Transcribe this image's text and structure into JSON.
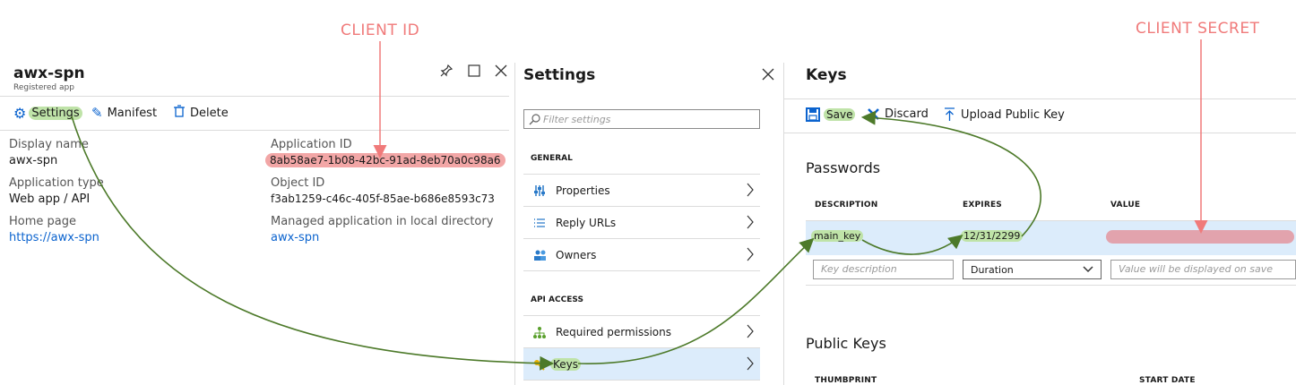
{
  "annotations": {
    "client_id": "CLIENT ID",
    "client_secret": "CLIENT SECRET"
  },
  "left_panel": {
    "title": "awx-spn",
    "subtitle": "Registered app",
    "toolbar": {
      "settings": "Settings",
      "manifest": "Manifest",
      "delete": "Delete"
    },
    "fields": [
      {
        "label": "Display name",
        "value": "awx-spn"
      },
      {
        "label": "Application type",
        "value": "Web app / API"
      },
      {
        "label": "Home page",
        "value": "https://awx-spn"
      },
      {
        "label": "Application ID",
        "value": "8ab58ae7-1b08-42bc-91ad-8eb70a0c98a6"
      },
      {
        "label": "Object ID",
        "value": "f3ab1259-c46c-405f-85ae-b686e8593c73"
      },
      {
        "label": "Managed application in local directory",
        "value": "awx-spn"
      }
    ]
  },
  "settings_panel": {
    "title": "Settings",
    "filter_placeholder": "Filter settings",
    "general_header": "GENERAL",
    "api_header": "API ACCESS",
    "items": [
      {
        "label": "Properties"
      },
      {
        "label": "Reply URLs"
      },
      {
        "label": "Owners"
      },
      {
        "label": "Required permissions"
      },
      {
        "label": "Keys"
      }
    ]
  },
  "keys_panel": {
    "title": "Keys",
    "toolbar": {
      "save": "Save",
      "discard": "Discard",
      "upload": "Upload Public Key"
    },
    "passwords_title": "Passwords",
    "columns": {
      "description": "DESCRIPTION",
      "expires": "EXPIRES",
      "value": "VALUE"
    },
    "row": {
      "description": "main_key",
      "expires": "12/31/2299"
    },
    "new_row": {
      "description_placeholder": "Key description",
      "duration": "Duration",
      "value_placeholder": "Value will be displayed on save"
    },
    "public_keys_title": "Public Keys",
    "pk_columns": {
      "thumbprint": "THUMBPRINT",
      "start_date": "START DATE"
    }
  },
  "colors": {
    "accent": "#0b63ce",
    "highlight_green": "#bfe3a8",
    "highlight_red": "#f2a6a6",
    "annotation": "#f07a7a",
    "arrow": "#4d7a2a",
    "selected_row": "#dcecfb"
  }
}
